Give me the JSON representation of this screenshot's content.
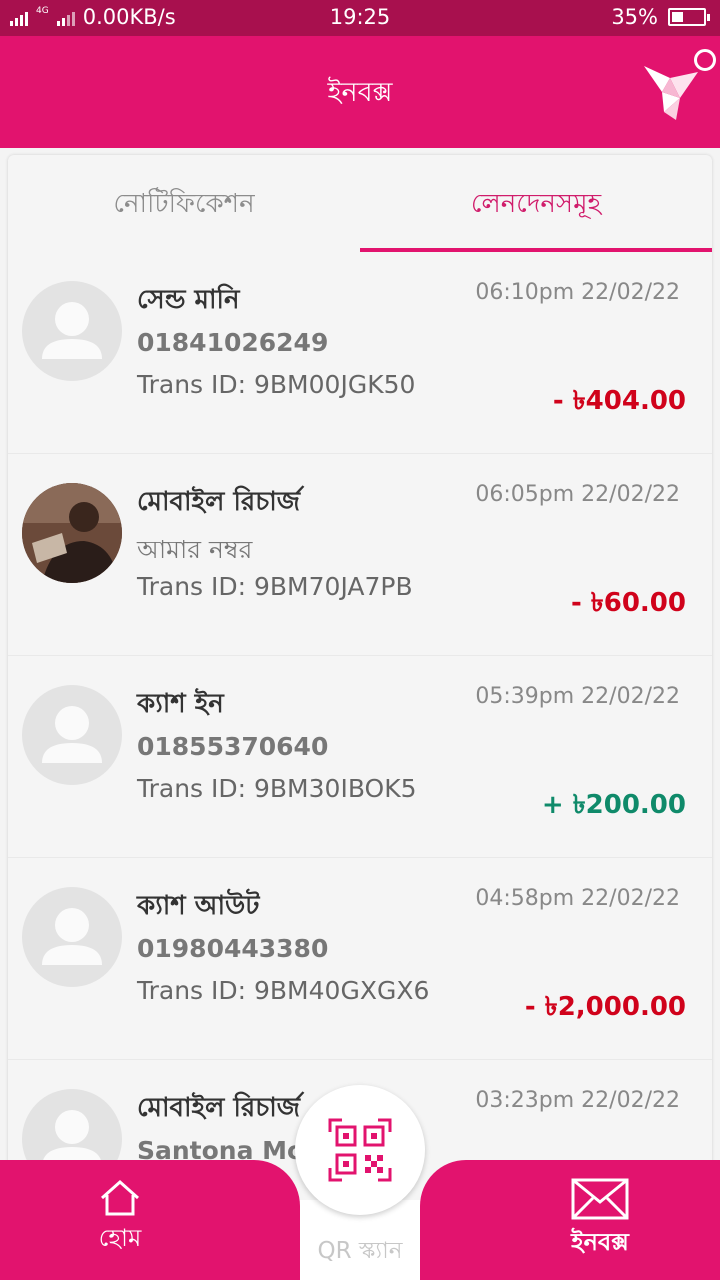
{
  "status_bar": {
    "network": "4G",
    "speed": "0.00KB/s",
    "time": "19:25",
    "battery": "35%",
    "battery_level": 0.35
  },
  "header": {
    "title": "ইনবক্স"
  },
  "tabs": [
    {
      "label": "নোটিফিকেশন",
      "active": false
    },
    {
      "label": "লেনদেনসমূহ",
      "active": true
    }
  ],
  "transactions": [
    {
      "title": "সেন্ড মানি",
      "subtitle": "01841026249",
      "trans_id": "Trans ID: 9BM00JGK50",
      "time": "06:10pm 22/02/22",
      "amount": "- ৳404.00",
      "direction": "debit"
    },
    {
      "title": "মোবাইল রিচার্জ",
      "subtitle": "আমার নম্বর",
      "trans_id": "Trans ID: 9BM70JA7PB",
      "time": "06:05pm 22/02/22",
      "amount": "- ৳60.00",
      "direction": "debit"
    },
    {
      "title": "ক্যাশ ইন",
      "subtitle": "01855370640",
      "trans_id": "Trans ID: 9BM30IBOK5",
      "time": "05:39pm 22/02/22",
      "amount": "+ ৳200.00",
      "direction": "credit"
    },
    {
      "title": "ক্যাশ আউট",
      "subtitle": "01980443380",
      "trans_id": "Trans ID: 9BM40GXGX6",
      "time": "04:58pm 22/02/22",
      "amount": "- ৳2,000.00",
      "direction": "debit"
    },
    {
      "title": "মোবাইল রিচার্জ",
      "subtitle": "Santona Mol",
      "trans_id": "",
      "time": "03:23pm 22/02/22",
      "amount": "",
      "direction": "debit"
    }
  ],
  "bottom_nav": {
    "home": "হোম",
    "qr": "QR স্ক্যান",
    "inbox": "ইনবক্স"
  },
  "colors": {
    "brand": "#e2136e",
    "status_bar": "#a8104e",
    "debit": "#d0021b",
    "credit": "#0f8a6a"
  },
  "icons": [
    "signal-icon",
    "battery-icon",
    "bkash-bird-logo-icon",
    "person-placeholder-icon",
    "home-icon",
    "qr-code-icon",
    "envelope-icon"
  ]
}
